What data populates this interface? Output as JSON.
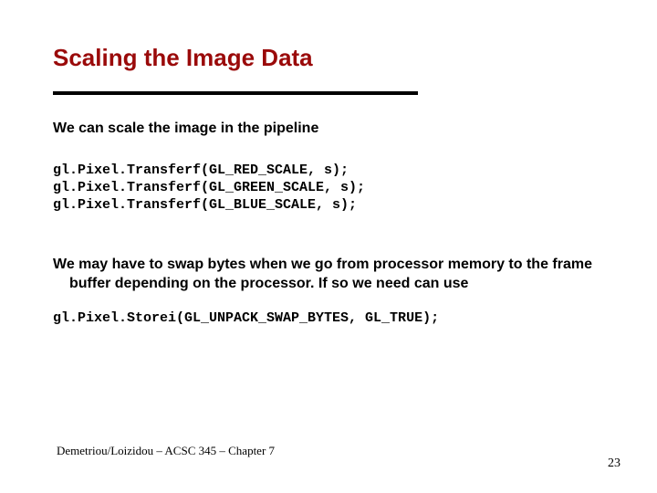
{
  "title": "Scaling the Image Data",
  "intro": "We can scale the image in the pipeline",
  "codeBlock1": "gl.Pixel.Transferf(GL_RED_SCALE, s);\ngl.Pixel.Transferf(GL_GREEN_SCALE, s);\ngl.Pixel.Transferf(GL_BLUE_SCALE, s);",
  "para2": "We may have to swap bytes when we go from processor memory to the frame buffer depending on the processor. If so we need can use",
  "codeBlock2": "gl.Pixel.Storei(GL_UNPACK_SWAP_BYTES, GL_TRUE);",
  "footerLeft": "Demetriou/Loizidou – ACSC 345 – Chapter 7",
  "footerRight": "23"
}
